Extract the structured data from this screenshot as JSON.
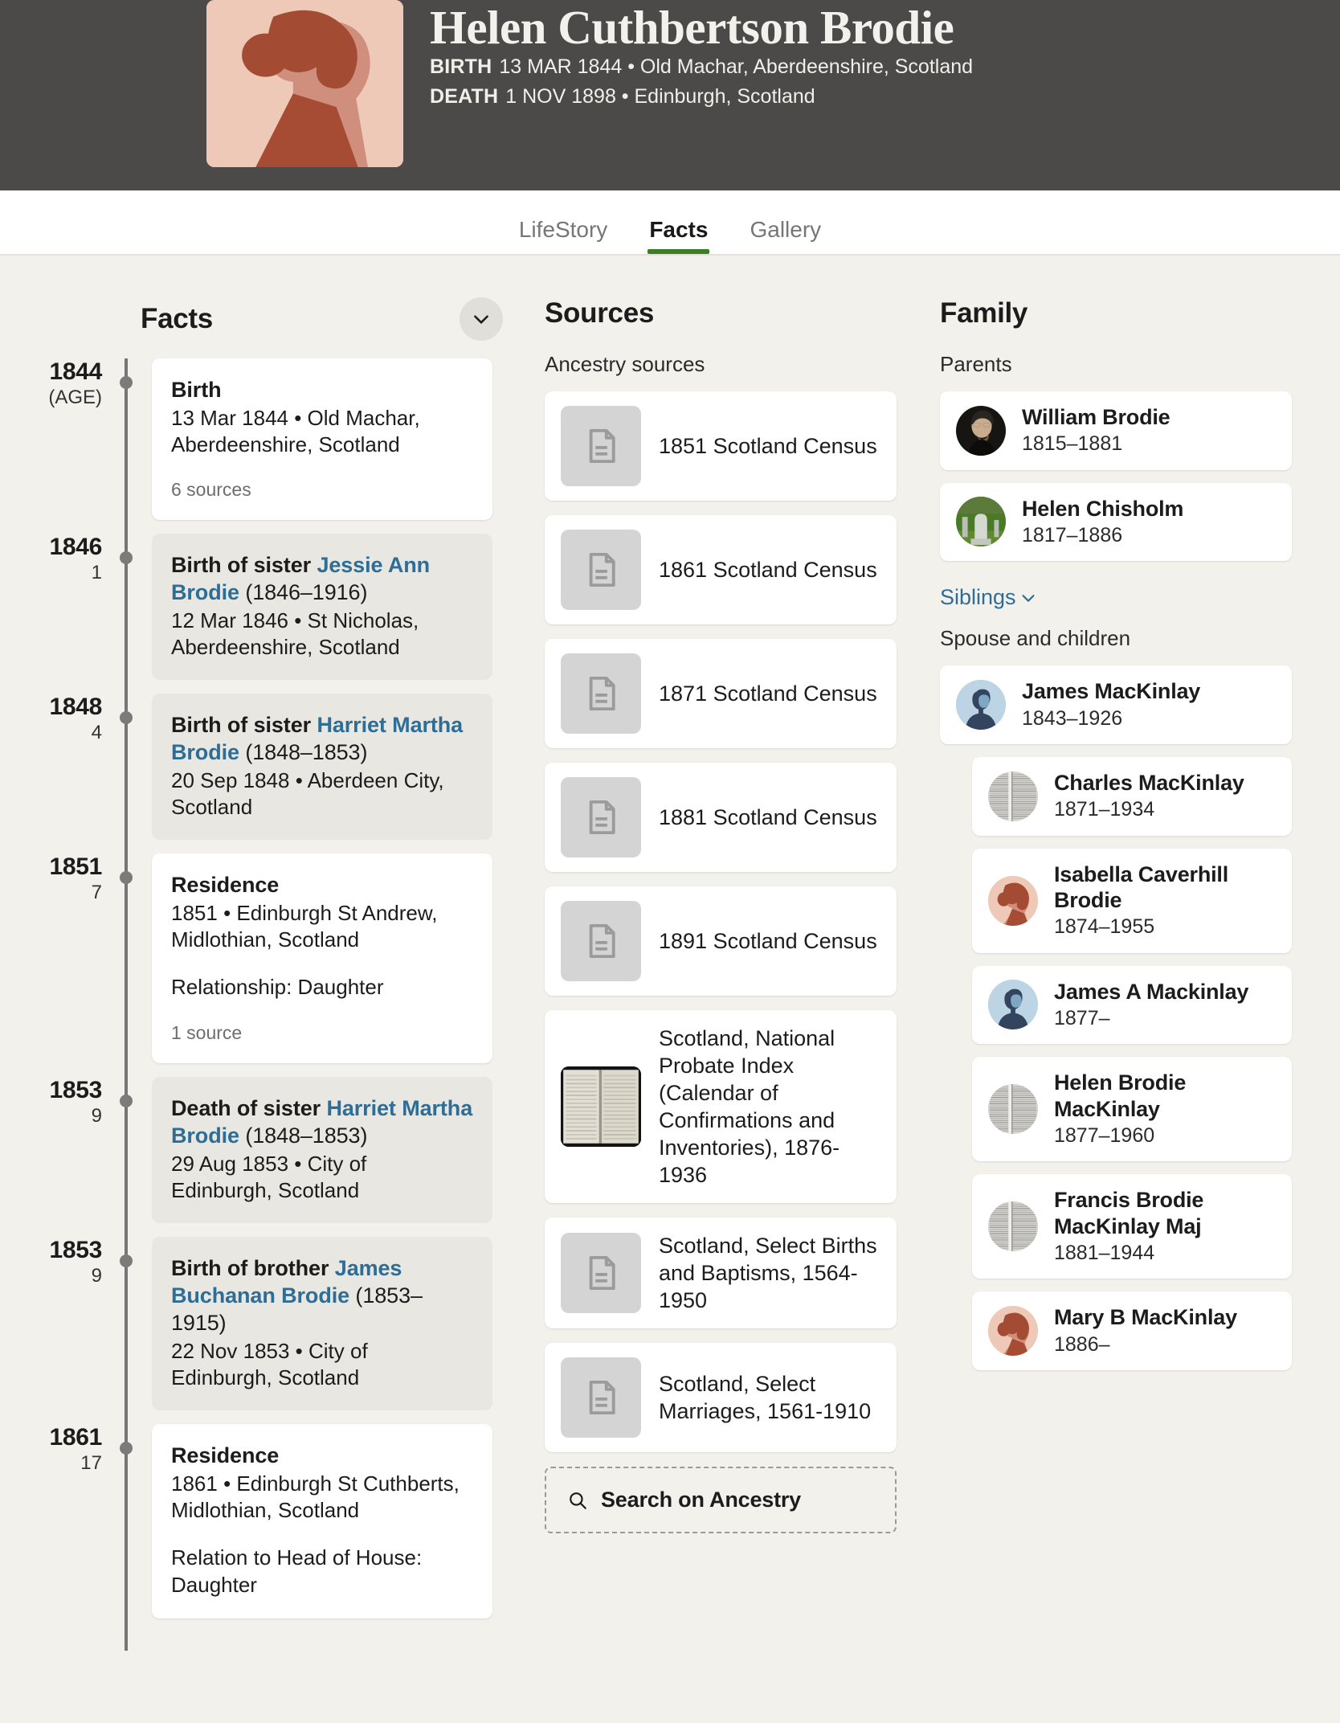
{
  "header": {
    "name": "Helen Cuthbertson Brodie",
    "birth_label": "BIRTH",
    "birth_value": "13 MAR 1844 • Old Machar, Aberdeenshire, Scotland",
    "death_label": "DEATH",
    "death_value": "1 NOV 1898 • Edinburgh, Scotland",
    "avatar_bg": "#eec9b7",
    "avatar_fg": "#a64b34",
    "bg": "#4b4a49"
  },
  "tabs": [
    {
      "label": "LifeStory",
      "active": false
    },
    {
      "label": "Facts",
      "active": true
    },
    {
      "label": "Gallery",
      "active": false
    }
  ],
  "accent_green": "#3e7d28",
  "link_blue": "#2d6d96",
  "facts": {
    "title": "Facts",
    "collapse_icon": "chevron-down-icon",
    "age_caption": "(AGE)",
    "events": [
      {
        "year": "1844",
        "age": "(AGE)",
        "style": "white",
        "title_plain": "Birth",
        "title_link": "",
        "title_tail": "",
        "line": "13 Mar 1844 • Old Machar, Aberdeenshire, Scotland",
        "extra": "",
        "sources": "6 sources"
      },
      {
        "year": "1846",
        "age": "1",
        "style": "muted",
        "title_plain": "Birth of sister ",
        "title_link": "Jessie Ann Brodie",
        "title_tail": " (1846–1916)",
        "line": "12 Mar 1846 • St Nicholas, Aberdeenshire, Scotland",
        "extra": "",
        "sources": ""
      },
      {
        "year": "1848",
        "age": "4",
        "style": "muted",
        "title_plain": "Birth of sister ",
        "title_link": "Harriet Martha Brodie",
        "title_tail": " (1848–1853)",
        "line": "20 Sep 1848 • Aberdeen City, Scotland",
        "extra": "",
        "sources": ""
      },
      {
        "year": "1851",
        "age": "7",
        "style": "white",
        "title_plain": "Residence",
        "title_link": "",
        "title_tail": "",
        "line": "1851 • Edinburgh St Andrew, Midlothian, Scotland",
        "extra": "Relationship: Daughter",
        "sources": "1 source"
      },
      {
        "year": "1853",
        "age": "9",
        "style": "muted",
        "title_plain": "Death of sister ",
        "title_link": "Harriet Martha Brodie",
        "title_tail": " (1848–1853)",
        "line": "29 Aug 1853 • City of Edinburgh, Scotland",
        "extra": "",
        "sources": ""
      },
      {
        "year": "1853",
        "age": "9",
        "style": "muted",
        "title_plain": "Birth of brother ",
        "title_link": "James Buchanan Brodie",
        "title_tail": " (1853–1915)",
        "line": "22 Nov 1853 • City of Edinburgh, Scotland",
        "extra": "",
        "sources": ""
      },
      {
        "year": "1861",
        "age": "17",
        "style": "white",
        "title_plain": "Residence",
        "title_link": "",
        "title_tail": "",
        "line": "1861 • Edinburgh St Cuthberts, Midlothian, Scotland",
        "extra": "Relation to Head of House: Daughter",
        "sources": ""
      }
    ]
  },
  "sources": {
    "title": "Sources",
    "subtitle": "Ancestry sources",
    "items": [
      {
        "name": "1851 Scotland Census",
        "thumb": "document-icon"
      },
      {
        "name": "1861 Scotland Census",
        "thumb": "document-icon"
      },
      {
        "name": "1871 Scotland Census",
        "thumb": "document-icon"
      },
      {
        "name": "1881 Scotland Census",
        "thumb": "document-icon"
      },
      {
        "name": "1891 Scotland Census",
        "thumb": "document-icon"
      },
      {
        "name": "Scotland, National Probate Index (Calendar of Confirmations and Inventories), 1876-1936",
        "thumb": "open-book-image"
      },
      {
        "name": "Scotland, Select Births and Baptisms, 1564-1950",
        "thumb": "document-icon"
      },
      {
        "name": "Scotland, Select Marriages, 1561-1910",
        "thumb": "document-icon"
      }
    ],
    "search_button": {
      "label": "Search on Ancestry",
      "icon": "search-icon"
    }
  },
  "family": {
    "title": "Family",
    "parents_label": "Parents",
    "parents": [
      {
        "name": "William Brodie",
        "dates": "1815–1881",
        "avatar": "photo-portrait-dark"
      },
      {
        "name": "Helen Chisholm",
        "dates": "1817–1886",
        "avatar": "photo-gravestone-green"
      }
    ],
    "siblings_link": {
      "label": "Siblings",
      "icon": "chevron-down-icon"
    },
    "spouse_children_label": "Spouse and children",
    "spouse": {
      "name": "James MacKinlay",
      "dates": "1843–1926",
      "avatar": "silhouette-male-blue"
    },
    "children": [
      {
        "name": "Charles MacKinlay",
        "dates": "1871–1934",
        "avatar": "document-scan-gray"
      },
      {
        "name": "Isabella Caverhill Brodie",
        "dates": "1874–1955",
        "avatar": "silhouette-female-peach"
      },
      {
        "name": "James A Mackinlay",
        "dates": "1877–",
        "avatar": "silhouette-male-blue"
      },
      {
        "name": "Helen Brodie MacKinlay",
        "dates": "1877–1960",
        "avatar": "document-scan-gray"
      },
      {
        "name": "Francis Brodie MacKinlay Maj",
        "dates": "1881–1944",
        "avatar": "document-scan-gray"
      },
      {
        "name": "Mary B MacKinlay",
        "dates": "1886–",
        "avatar": "silhouette-female-peach"
      }
    ]
  }
}
